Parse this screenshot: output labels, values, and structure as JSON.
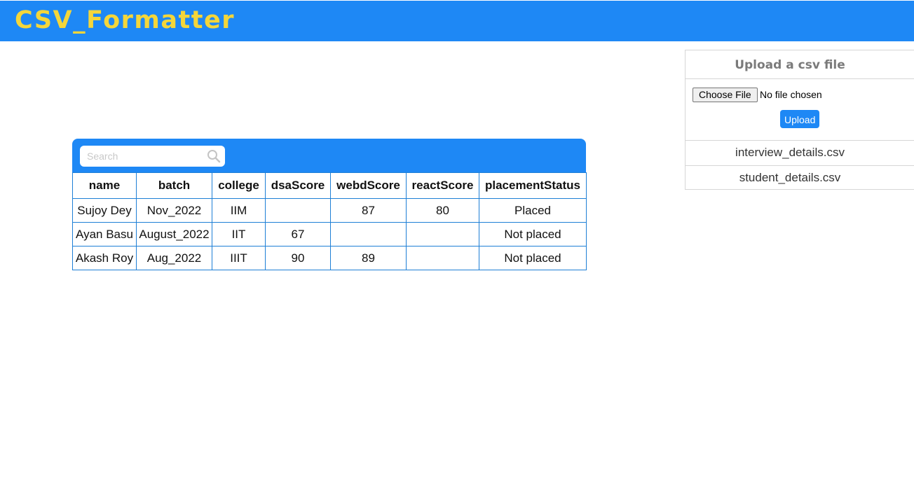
{
  "app": {
    "title": "CSV_Formatter"
  },
  "search": {
    "placeholder": "Search",
    "value": ""
  },
  "table": {
    "columns": [
      "name",
      "batch",
      "college",
      "dsaScore",
      "webdScore",
      "reactScore",
      "placementStatus"
    ],
    "rows": [
      [
        "Sujoy Dey",
        "Nov_2022",
        "IIM",
        "",
        "87",
        "80",
        "Placed"
      ],
      [
        "Ayan Basu",
        "August_2022",
        "IIT",
        "67",
        "",
        "",
        "Not placed"
      ],
      [
        "Akash Roy",
        "Aug_2022",
        "IIIT",
        "90",
        "89",
        "",
        "Not placed"
      ]
    ]
  },
  "upload": {
    "title": "Upload a csv file",
    "choose_label": "Choose File",
    "file_status": "No file chosen",
    "upload_label": "Upload",
    "files": [
      "interview_details.csv",
      "student_details.csv"
    ]
  },
  "colors": {
    "primary": "#1e88f5",
    "title_yellow": "#f4d63a",
    "table_border": "#1e7fd6"
  },
  "icons": {
    "search": "search-icon"
  }
}
